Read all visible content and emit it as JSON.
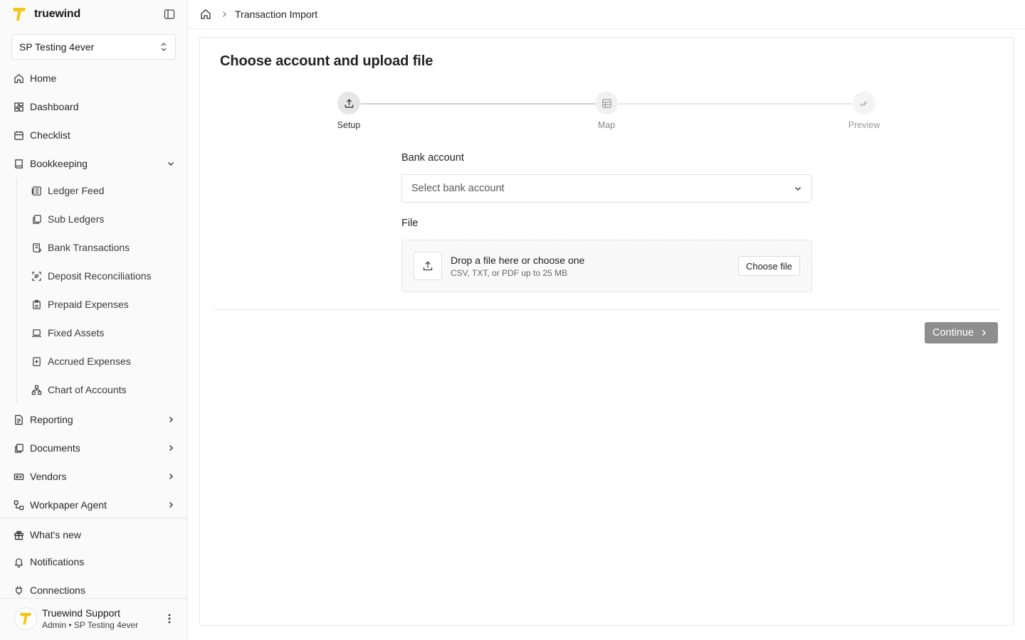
{
  "app": {
    "brand": "truewind",
    "org": "SP Testing 4ever"
  },
  "sidebar": {
    "items": [
      {
        "label": "Home",
        "icon": "home-icon"
      },
      {
        "label": "Dashboard",
        "icon": "dashboard-icon"
      },
      {
        "label": "Checklist",
        "icon": "calendar-icon"
      },
      {
        "label": "Bookkeeping",
        "icon": "book-icon"
      }
    ],
    "bookkeeping_sub": [
      {
        "label": "Ledger Feed",
        "icon": "ledger-icon"
      },
      {
        "label": "Sub Ledgers",
        "icon": "copy-icon"
      },
      {
        "label": "Bank Transactions",
        "icon": "receipt-icon"
      },
      {
        "label": "Deposit Reconciliations",
        "icon": "scan-icon"
      },
      {
        "label": "Prepaid Expenses",
        "icon": "clipboard-icon"
      },
      {
        "label": "Fixed Assets",
        "icon": "laptop-icon"
      },
      {
        "label": "Accrued Expenses",
        "icon": "plus-file-icon"
      },
      {
        "label": "Chart of Accounts",
        "icon": "hierarchy-icon"
      }
    ],
    "more": [
      {
        "label": "Reporting",
        "icon": "report-icon"
      },
      {
        "label": "Documents",
        "icon": "documents-icon"
      },
      {
        "label": "Vendors",
        "icon": "vendor-icon"
      },
      {
        "label": "Workpaper Agent",
        "icon": "workflow-icon"
      }
    ],
    "footer": [
      {
        "label": "What's new",
        "icon": "gift-icon"
      },
      {
        "label": "Notifications",
        "icon": "bell-icon"
      },
      {
        "label": "Connections",
        "icon": "plug-icon"
      }
    ],
    "user": {
      "name": "Truewind Support",
      "sub": "Admin • SP Testing 4ever"
    }
  },
  "header": {
    "breadcrumb": "Transaction Import"
  },
  "main": {
    "title": "Choose account and upload file",
    "steps": [
      {
        "label": "Setup",
        "state": "active"
      },
      {
        "label": "Map",
        "state": "inactive"
      },
      {
        "label": "Preview",
        "state": "inactive"
      }
    ],
    "bank_label": "Bank account",
    "bank_placeholder": "Select bank account",
    "file_label": "File",
    "drop_title": "Drop a file here or choose one",
    "drop_sub": "CSV, TXT, or PDF up to 25 MB",
    "choose_btn": "Choose file",
    "continue_btn": "Continue"
  },
  "colors": {
    "brand_yellow": "#F5C518",
    "continue_bg": "#8e8e8e"
  }
}
